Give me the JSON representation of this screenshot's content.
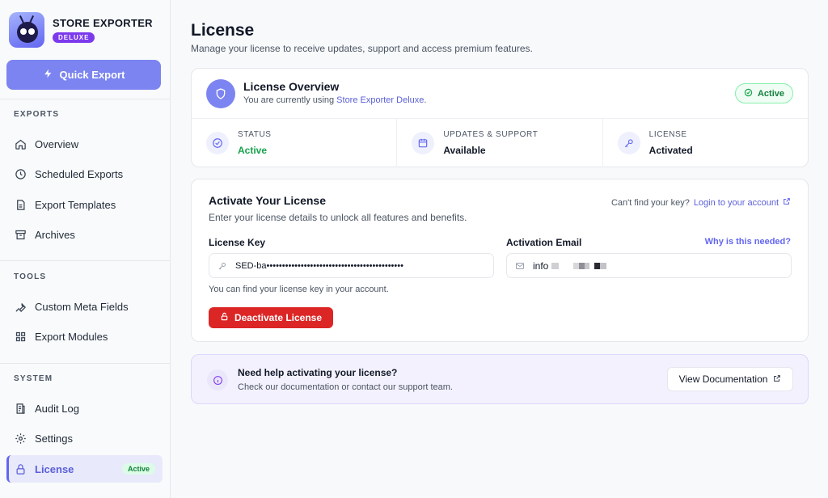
{
  "brand": {
    "name": "STORE EXPORTER",
    "badge": "DELUXE"
  },
  "quick_export": {
    "label": "Quick Export",
    "icon": "lightning-icon"
  },
  "sidebar": {
    "sections": [
      {
        "title": "EXPORTS",
        "items": [
          {
            "label": "Overview",
            "icon": "home-icon"
          },
          {
            "label": "Scheduled Exports",
            "icon": "clock-icon"
          },
          {
            "label": "Export Templates",
            "icon": "document-icon"
          },
          {
            "label": "Archives",
            "icon": "archive-icon"
          }
        ]
      },
      {
        "title": "TOOLS",
        "items": [
          {
            "label": "Custom Meta Fields",
            "icon": "wrench-icon"
          },
          {
            "label": "Export Modules",
            "icon": "grid-icon"
          }
        ]
      },
      {
        "title": "SYSTEM",
        "items": [
          {
            "label": "Audit Log",
            "icon": "log-icon"
          },
          {
            "label": "Settings",
            "icon": "gear-icon"
          },
          {
            "label": "License",
            "icon": "lock-icon",
            "badge": "Active",
            "active": true
          }
        ]
      }
    ]
  },
  "page": {
    "title": "License",
    "subtitle": "Manage your license to receive updates, support and access premium features."
  },
  "overview": {
    "title": "License Overview",
    "subtitle_prefix": "You are currently using ",
    "product_link": "Store Exporter Deluxe",
    "subtitle_suffix": ".",
    "status_pill": "Active",
    "stats": [
      {
        "label": "STATUS",
        "value": "Active",
        "icon": "check-circle-icon"
      },
      {
        "label": "UPDATES & SUPPORT",
        "value": "Available",
        "icon": "calendar-icon"
      },
      {
        "label": "LICENSE",
        "value": "Activated",
        "icon": "key-icon"
      }
    ]
  },
  "activate": {
    "title": "Activate Your License",
    "subtitle": "Enter your license details to unlock all features and benefits.",
    "help_text": "Can't find your key?",
    "help_link": "Login to your account",
    "license_key_label": "License Key",
    "license_key_value": "SED-ba••••••••••••••••••••••••••••••••••••••••••••",
    "email_label": "Activation Email",
    "why_link": "Why is this needed?",
    "email_value": "info",
    "hint": "You can find your license key in your account.",
    "deactivate_label": "Deactivate License"
  },
  "help": {
    "title": "Need help activating your license?",
    "subtitle": "Check our documentation or contact our support team.",
    "button": "View Documentation"
  },
  "colors": {
    "accent": "#7b84f0",
    "danger": "#dc2626",
    "success": "#16a34a"
  }
}
